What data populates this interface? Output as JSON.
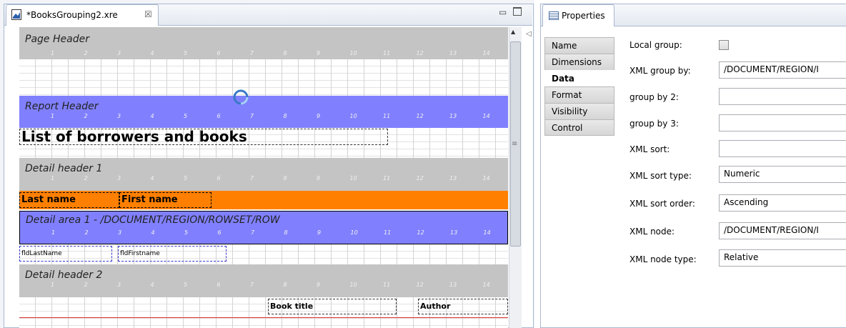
{
  "editor": {
    "tab_title": "*BooksGrouping2.xre",
    "close_glyph": "☒",
    "minimize_glyph": "▭",
    "collapse_glyph": "◁",
    "scroll_up_glyph": "▲",
    "thumb_grip_glyph": "≡"
  },
  "ruler_numbers": [
    "1",
    "2",
    "3",
    "4",
    "5",
    "6",
    "7",
    "8",
    "9",
    "10",
    "11",
    "12",
    "13",
    "14"
  ],
  "bands": {
    "page_header": "Page Header",
    "report_header": "Report Header",
    "detail_header_1": "Detail header 1",
    "detail_area_1": "Detail area 1 - /DOCUMENT/REGION/ROWSET/ROW",
    "detail_header_2": "Detail header 2"
  },
  "fields": {
    "title": "List of borrowers and books",
    "last_name": "Last name",
    "first_name": "First name",
    "fld_last_name": "fldLastName",
    "fld_first_name": "fldFirstname",
    "book_title": "Book title",
    "author": "Author"
  },
  "properties": {
    "tab_title": "Properties",
    "side_tabs": [
      "Name",
      "Dimensions",
      "Data",
      "Format",
      "Visibility",
      "Control"
    ],
    "selected_tab": "Data",
    "rows": {
      "local_group": {
        "label": "Local group:",
        "checked": false
      },
      "xml_group_by": {
        "label": "XML group by:",
        "value": "/DOCUMENT/REGION/I"
      },
      "group_by_2": {
        "label": "group by 2:",
        "value": ""
      },
      "group_by_3": {
        "label": "group by 3:",
        "value": ""
      },
      "xml_sort": {
        "label": "XML sort:",
        "value": ""
      },
      "xml_sort_type": {
        "label": "XML sort type:",
        "value": "Numeric"
      },
      "xml_sort_order": {
        "label": "XML sort order:",
        "value": "Ascending"
      },
      "xml_node": {
        "label": "XML node:",
        "value": "/DOCUMENT/REGION/I"
      },
      "xml_node_type": {
        "label": "XML node type:",
        "value": "Relative"
      }
    }
  },
  "colors": {
    "band_gray": "#c4c4c4",
    "band_blue": "#8080ff",
    "band_orange": "#ff8000"
  },
  "icons": [
    "report-file-icon",
    "close-tab-icon",
    "minimize-icon",
    "maximize-icon",
    "properties-icon",
    "busy-spinner-icon"
  ]
}
